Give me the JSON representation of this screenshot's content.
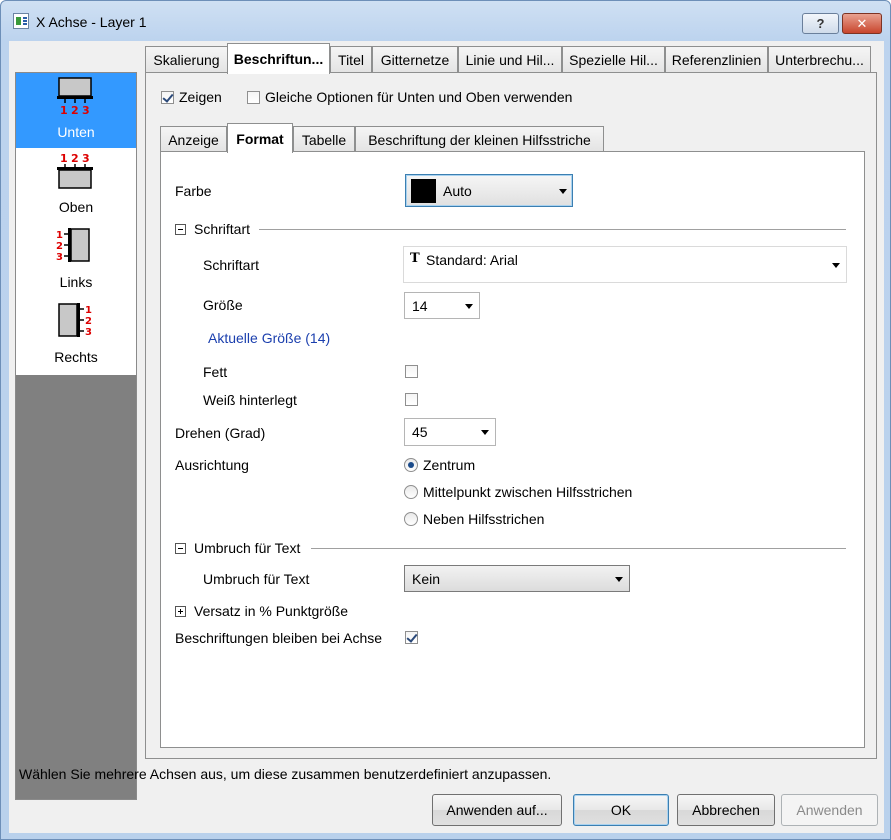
{
  "window": {
    "title": "X Achse - Layer 1",
    "help_label": "?",
    "close_label": "✕"
  },
  "sidebar": {
    "items": [
      {
        "label": "Unten",
        "selected": true
      },
      {
        "label": "Oben",
        "selected": false
      },
      {
        "label": "Links",
        "selected": false
      },
      {
        "label": "Rechts",
        "selected": false
      }
    ]
  },
  "top_tabs": [
    {
      "label": "Skalierung"
    },
    {
      "label": "Beschriftun..."
    },
    {
      "label": "Titel"
    },
    {
      "label": "Gitternetze"
    },
    {
      "label": "Linie und Hil..."
    },
    {
      "label": "Spezielle Hil..."
    },
    {
      "label": "Referenzlinien"
    },
    {
      "label": "Unterbrechu..."
    }
  ],
  "active_top_tab": "Beschriftun...",
  "options": {
    "show_label": "Zeigen",
    "show_checked": true,
    "same_options_label": "Gleiche Optionen für Unten und Oben verwenden",
    "same_options_checked": false
  },
  "sub_tabs": [
    {
      "label": "Anzeige"
    },
    {
      "label": "Format"
    },
    {
      "label": "Tabelle"
    },
    {
      "label": "Beschriftung der kleinen Hilfsstriche"
    }
  ],
  "active_sub_tab": "Format",
  "format": {
    "color_label": "Farbe",
    "color_value": "Auto",
    "color_swatch": "#000000",
    "font_section_label": "Schriftart",
    "font_label": "Schriftart",
    "font_value": "Standard: Arial",
    "size_label": "Größe",
    "size_value": "14",
    "current_size_link": "Aktuelle Größe (14)",
    "bold_label": "Fett",
    "bold_checked": false,
    "white_bg_label": "Weiß hinterlegt",
    "white_bg_checked": false,
    "rotate_label": "Drehen (Grad)",
    "rotate_value": "45",
    "alignment_label": "Ausrichtung",
    "alignment_options": [
      {
        "label": "Zentrum",
        "checked": true
      },
      {
        "label": "Mittelpunkt zwischen Hilfsstrichen",
        "checked": false
      },
      {
        "label": "Neben Hilfsstrichen",
        "checked": false
      }
    ],
    "wrap_section_label": "Umbruch für Text",
    "wrap_label": "Umbruch für Text",
    "wrap_value": "Kein",
    "offset_section_label": "Versatz in % Punktgröße",
    "stay_with_axis_label": "Beschriftungen bleiben bei Achse",
    "stay_with_axis_checked": true
  },
  "status_text": "Wählen Sie mehrere Achsen aus, um diese zusammen benutzerdefiniert anzupassen.",
  "buttons": {
    "apply_to": "Anwenden auf...",
    "ok": "OK",
    "cancel": "Abbrechen",
    "apply": "Anwenden"
  },
  "colors": {
    "selection": "#3399ff",
    "link": "#1b3fae"
  }
}
